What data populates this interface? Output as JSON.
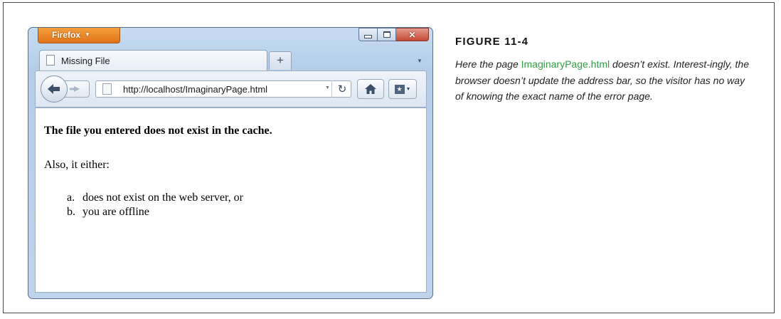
{
  "browser": {
    "app_button": "Firefox",
    "tab": {
      "title": "Missing File"
    },
    "new_tab": "+",
    "address": "http://localhost/ImaginaryPage.html"
  },
  "page": {
    "heading": "The file you entered does not exist in the cache.",
    "paragraph": "Also, it either:",
    "list": [
      {
        "marker": "a.",
        "text": "does not exist on the web server, or"
      },
      {
        "marker": "b.",
        "text": "you are offline"
      }
    ]
  },
  "figure": {
    "title": "FIGURE 11-4",
    "caption_before": "Here the page ",
    "caption_filename": "ImaginaryPage.html",
    "caption_after": " doesn’t exist. Interest-ingly, the browser doesn’t update the address bar, so the visitor has no way of knowing the exact name of the error page.",
    "filename_color": "#2f9e44"
  }
}
